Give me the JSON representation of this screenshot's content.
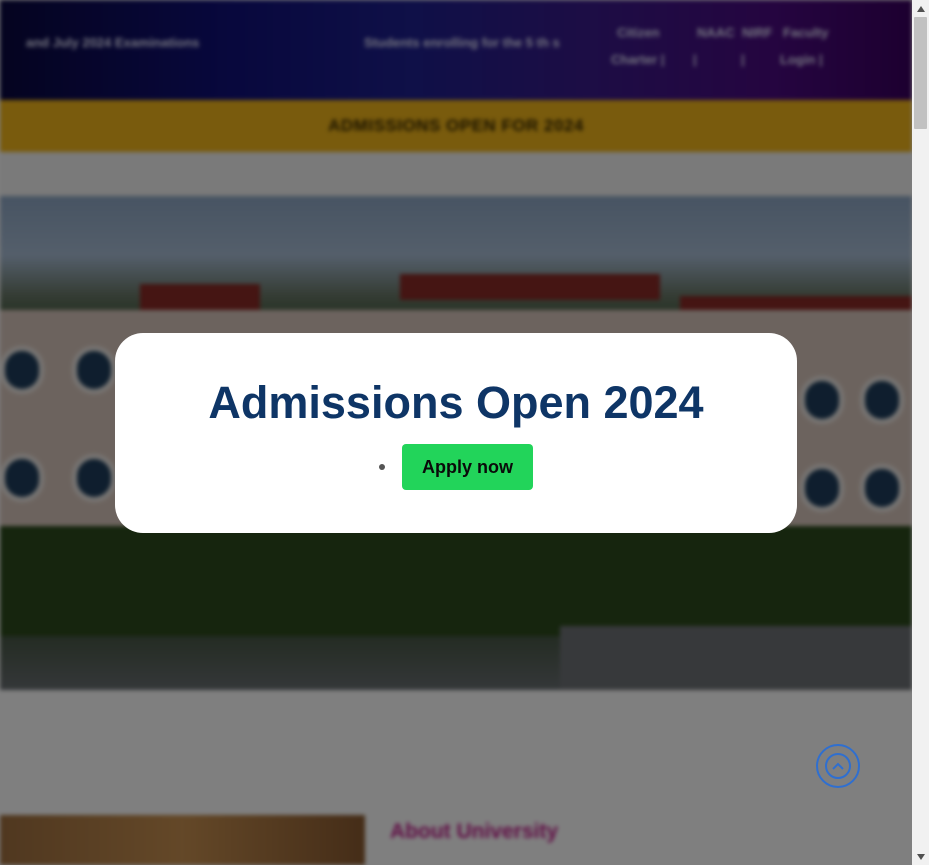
{
  "header": {
    "notice": "and July 2024 Examinations",
    "students_text": "Students enrolling for the 5 th s",
    "nav_citizen": "Citizen",
    "nav_charter": "Charter |",
    "nav_pipe1": "|",
    "nav_pipe2": "|",
    "nav_naac": "NAAC",
    "nav_nirf": "NIRF",
    "nav_faculty": "Faculty",
    "nav_login": "Login |"
  },
  "announcement": {
    "text": "ADMISSIONS OPEN FOR 2024"
  },
  "about": {
    "title": "About University"
  },
  "modal": {
    "title": "Admissions Open 2024",
    "apply_label": "Apply now"
  },
  "colors": {
    "modal_title": "#0e3566",
    "apply_button": "#22d45a",
    "announcement_bar": "#f2b61a",
    "about_title": "#c01a8a",
    "scroll_top": "#2f6fd0"
  },
  "icons": {
    "scroll_top": "chevron-up-icon",
    "scrollbar_up": "triangle-up-icon",
    "scrollbar_down": "triangle-down-icon"
  }
}
